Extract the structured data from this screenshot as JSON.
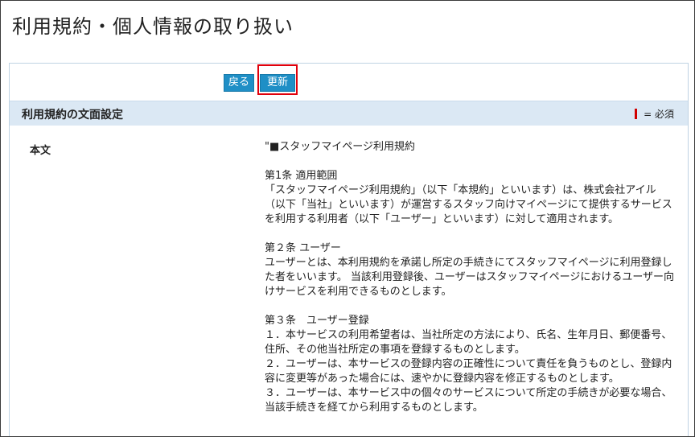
{
  "page": {
    "title": "利用規約・個人情報の取り扱い"
  },
  "toolbar": {
    "back_label": "戻る",
    "update_label": "更新"
  },
  "section": {
    "title": "利用規約の文面設定",
    "required_legend": "= 必須"
  },
  "field": {
    "label": "本文",
    "value": "\"■スタッフマイページ利用規約\n\n第1条 適用範囲\n「スタッフマイページ利用規約」（以下「本規約」といいます）は、株式会社アイル（以下「当社」といいます）が運営するスタッフ向けマイページにて提供するサービスを利用する利用者（以下「ユーザー」といいます）に対して適用されます。\n\n第２条 ユーザー\nユーザーとは、本利用規約を承諾し所定の手続きにてスタッフマイページに利用登録した者をいいます。 当該利用登録後、ユーザーはスタッフマイページにおけるユーザー向けサービスを利用できるものとします。\n\n第３条　ユーザー登録\n１．本サービスの利用希望者は、当社所定の方法により、氏名、生年月日、郵便番号、住所、その他当社所定の事項を登録するものとします。\n２．ユーザーは、本サービスの登録内容の正確性について責任を負うものとし、登録内容に変更等があった場合には、速やかに登録内容を修正するものとします。\n３．ユーザーは、本サービス中の個々のサービスについて所定の手続きが必要な場合、当該手続きを経てから利用するものとします。"
  },
  "colors": {
    "button": "#1f8fc6",
    "section_header": "#dbe8f4",
    "highlight": "#e0000b",
    "required_mark": "#d10000"
  }
}
